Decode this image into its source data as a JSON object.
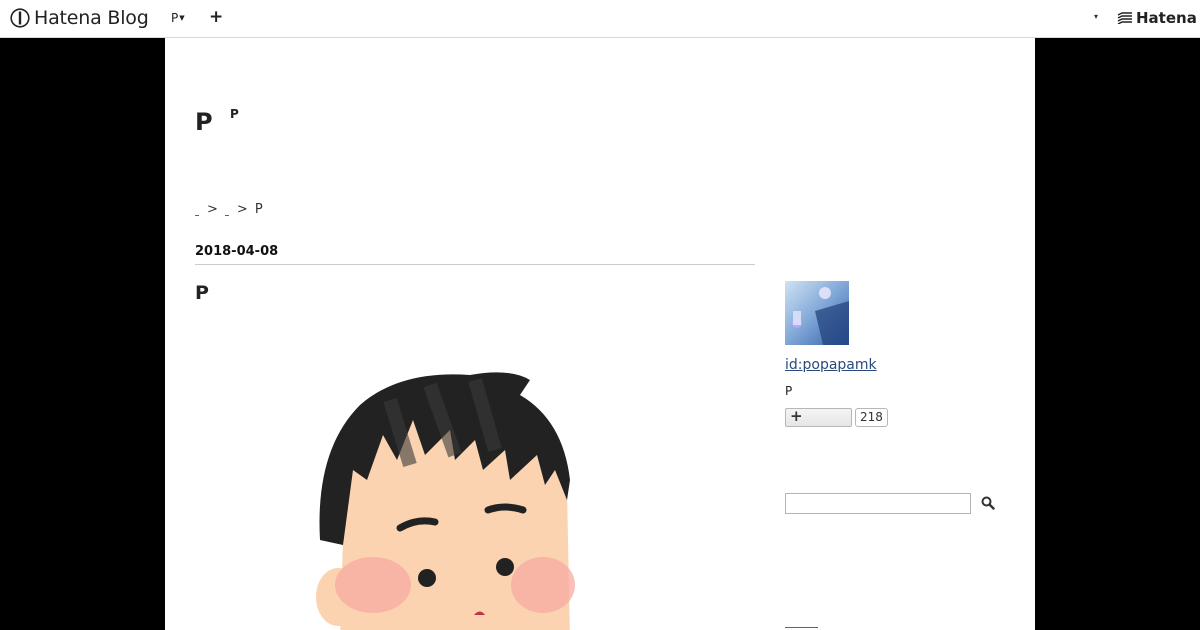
{
  "global_header": {
    "logo_text": "Hatena Blog",
    "menu_label": "P",
    "plus_label": "+",
    "dropdown_caret": "▾",
    "hatena_text": "Hatena"
  },
  "blog": {
    "title": "P",
    "description": "P"
  },
  "breadcrumb": {
    "items": [
      "",
      ""
    ],
    "separator": ">",
    "current": "P"
  },
  "entry": {
    "date": "2018-04-08",
    "title": "P"
  },
  "sidebar": {
    "profile_id": "id:popapamk",
    "profile_description": "P",
    "subscribe_label": "+",
    "subscriber_count": "218",
    "search_value": "",
    "search_placeholder": ""
  }
}
